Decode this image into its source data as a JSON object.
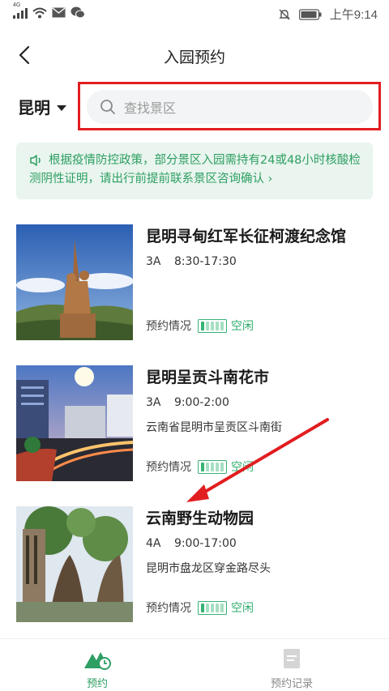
{
  "status_bar": {
    "network": "4G",
    "time": "上午9:14"
  },
  "header": {
    "title": "入园预约"
  },
  "city": {
    "name": "昆明"
  },
  "search": {
    "placeholder": "查找景区"
  },
  "notice": {
    "text": "根据疫情防控政策，部分景区入园需持有24或48小时核酸检测阴性证明，请出行前提前联系景区咨询确认",
    "arrow": "›"
  },
  "spots": [
    {
      "name": "昆明寻甸红军长征柯渡纪念馆",
      "level": "3A",
      "hours": "8:30-17:30",
      "address": "",
      "status_label": "预约情况",
      "status_value": "空闲"
    },
    {
      "name": "昆明呈贡斗南花市",
      "level": "3A",
      "hours": "9:00-2:00",
      "address": "云南省昆明市呈贡区斗南街",
      "status_label": "预约情况",
      "status_value": "空闲"
    },
    {
      "name": "云南野生动物园",
      "level": "4A",
      "hours": "9:00-17:00",
      "address": "昆明市盘龙区穿金路尽头",
      "status_label": "预约情况",
      "status_value": "空闲"
    }
  ],
  "tabs": [
    {
      "label": "预约",
      "icon": "mountain-clock-icon",
      "active": true
    },
    {
      "label": "预约记录",
      "icon": "document-icon",
      "active": false
    }
  ],
  "colors": {
    "accent": "#2e9e63",
    "highlight_red": "#e11d20",
    "notice_bg": "#e9f5ee"
  }
}
